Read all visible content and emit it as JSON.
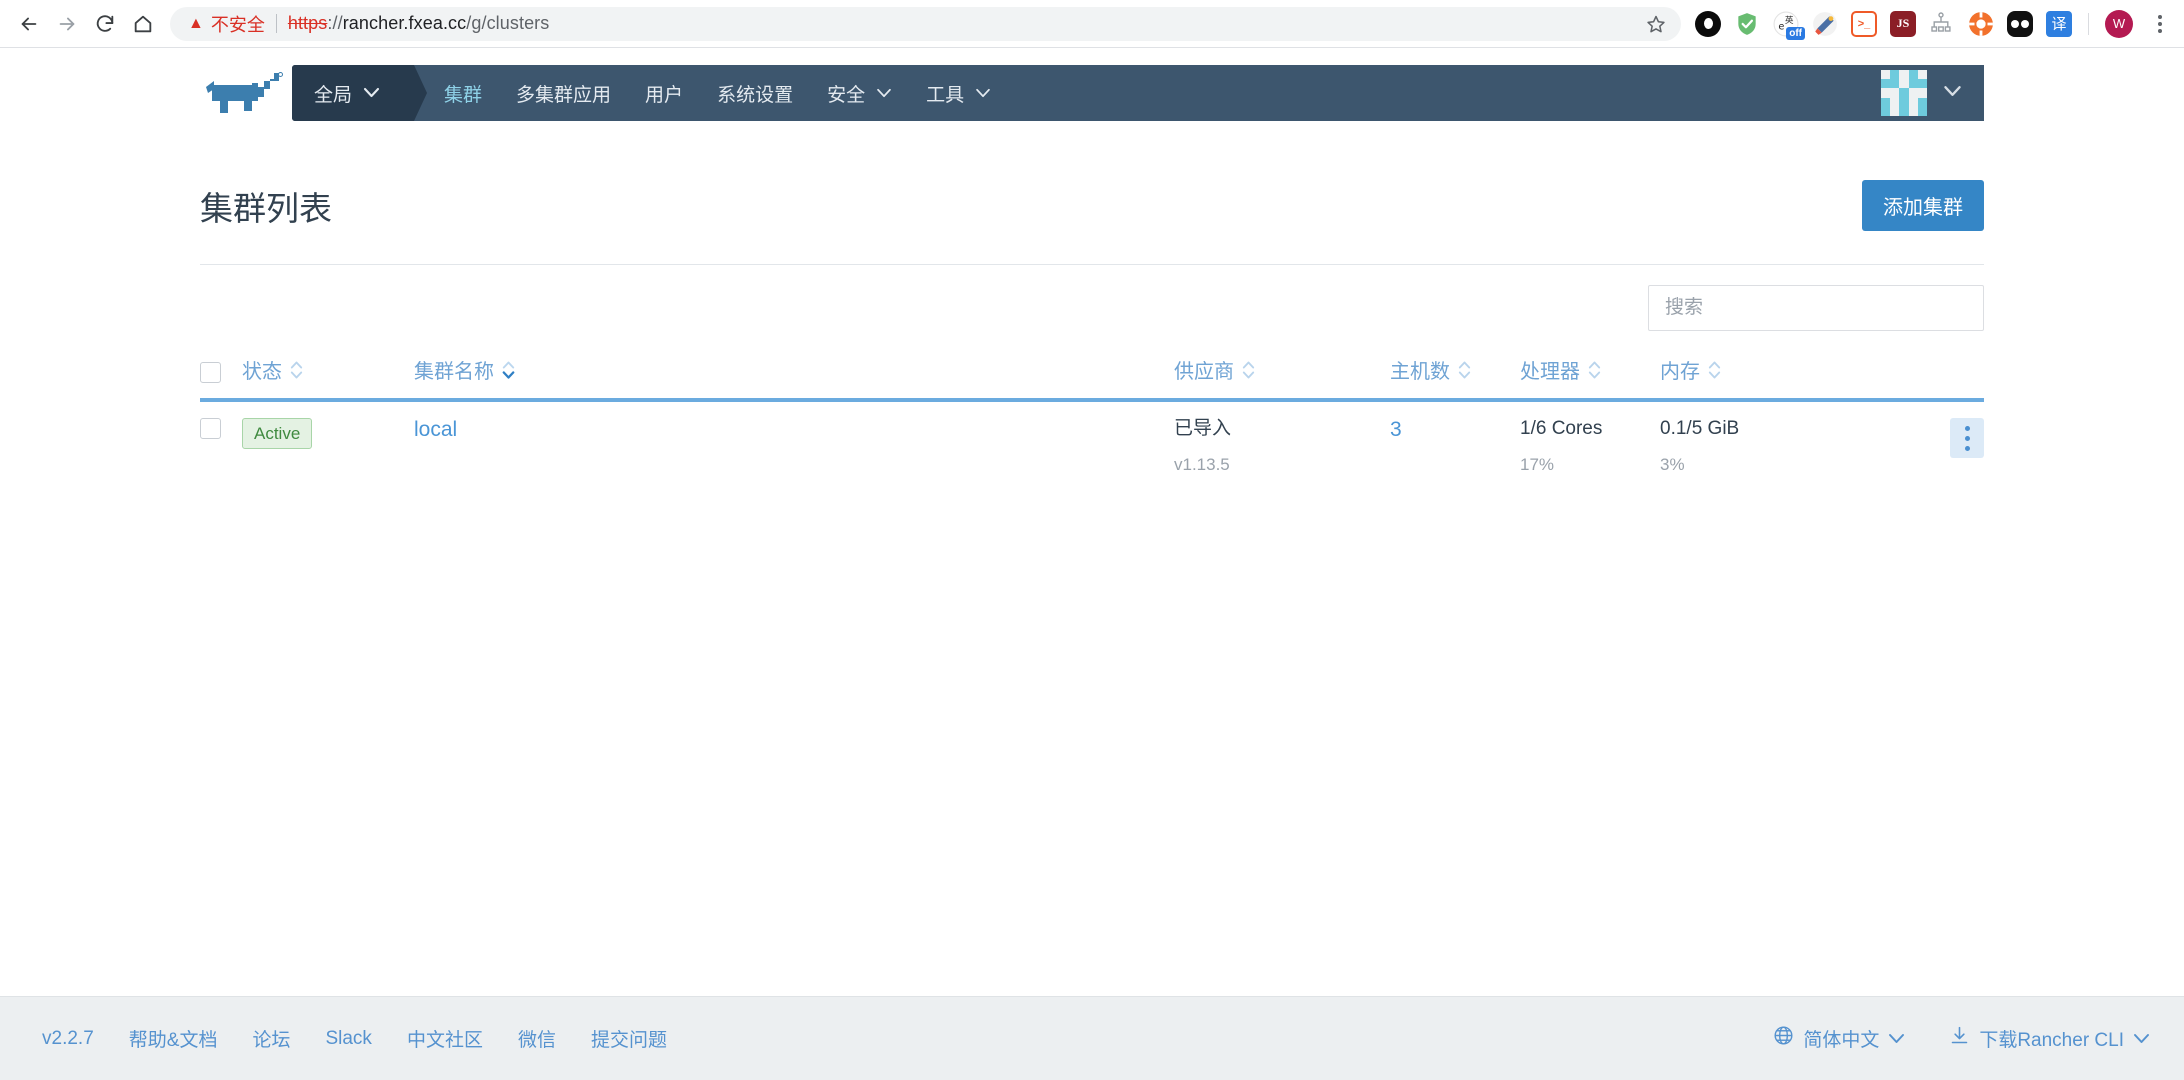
{
  "browser": {
    "back_icon": "back-arrow-icon",
    "forward_icon": "forward-arrow-icon",
    "reload_icon": "reload-icon",
    "home_icon": "home-icon",
    "security_warning": "不安全",
    "url_scheme": "https",
    "url_rest": "://rancher.fxea.cc/g/clusters",
    "url_host": "rancher.fxea.cc",
    "url_path": "/g/clusters",
    "url_separator": "://",
    "bookmark_icon": "star-icon",
    "extensions": [
      {
        "name": "opera-extension-icon",
        "label": ""
      },
      {
        "name": "adguard-shield-icon",
        "label": ""
      },
      {
        "name": "translate-toggle-icon",
        "label": "off"
      },
      {
        "name": "firework-extension-icon",
        "label": ""
      },
      {
        "name": "terminal-extension-icon",
        "label": ">_"
      },
      {
        "name": "javascript-extension-icon",
        "label": "JS"
      },
      {
        "name": "sitemap-extension-icon",
        "label": ""
      },
      {
        "name": "lifebuoy-extension-icon",
        "label": ""
      },
      {
        "name": "panda-extension-icon",
        "label": ""
      },
      {
        "name": "fanyi-translate-icon",
        "label": "译"
      }
    ],
    "profile_initial": "W",
    "menu_icon": "kebab-menu-icon"
  },
  "header": {
    "logo_name": "rancher-logo",
    "scope_label": "全局",
    "nav_items": [
      {
        "label": "集群",
        "active": true,
        "dropdown": false
      },
      {
        "label": "多集群应用",
        "active": false,
        "dropdown": false
      },
      {
        "label": "用户",
        "active": false,
        "dropdown": false
      },
      {
        "label": "系统设置",
        "active": false,
        "dropdown": false
      },
      {
        "label": "安全",
        "active": false,
        "dropdown": true
      },
      {
        "label": "工具",
        "active": false,
        "dropdown": true
      }
    ],
    "avatar_name": "user-identicon"
  },
  "page": {
    "title": "集群列表",
    "add_button": "添加集群"
  },
  "search": {
    "placeholder": "搜索",
    "value": ""
  },
  "table": {
    "columns": [
      {
        "key": "status",
        "label": "状态",
        "sortable": true
      },
      {
        "key": "name",
        "label": "集群名称",
        "sortable": true,
        "sorted": "asc"
      },
      {
        "key": "provider",
        "label": "供应商",
        "sortable": true
      },
      {
        "key": "hosts",
        "label": "主机数",
        "sortable": true
      },
      {
        "key": "cpu",
        "label": "处理器",
        "sortable": true
      },
      {
        "key": "memory",
        "label": "内存",
        "sortable": true
      }
    ],
    "rows": [
      {
        "status": "Active",
        "name": "local",
        "provider": "已导入",
        "provider_version": "v1.13.5",
        "hosts": "3",
        "cpu": "1/6 Cores",
        "cpu_percent": "17%",
        "memory": "0.1/5 GiB",
        "memory_percent": "3%"
      }
    ]
  },
  "footer": {
    "links": [
      "v2.2.7",
      "帮助&文档",
      "论坛",
      "Slack",
      "中文社区",
      "微信",
      "提交问题"
    ],
    "language": "简体中文",
    "language_icon": "globe-icon",
    "cli": "下载Rancher CLI",
    "cli_icon": "download-icon"
  },
  "colors": {
    "accent_blue": "#3586c6",
    "link_blue": "#4a95d6",
    "header_dark": "#3d566e",
    "scope_dark": "#273a4d",
    "active_nav": "#8fd2e8",
    "status_green": "#3f8a3f",
    "warning_red": "#d93025",
    "footer_bg": "#eceff1"
  }
}
